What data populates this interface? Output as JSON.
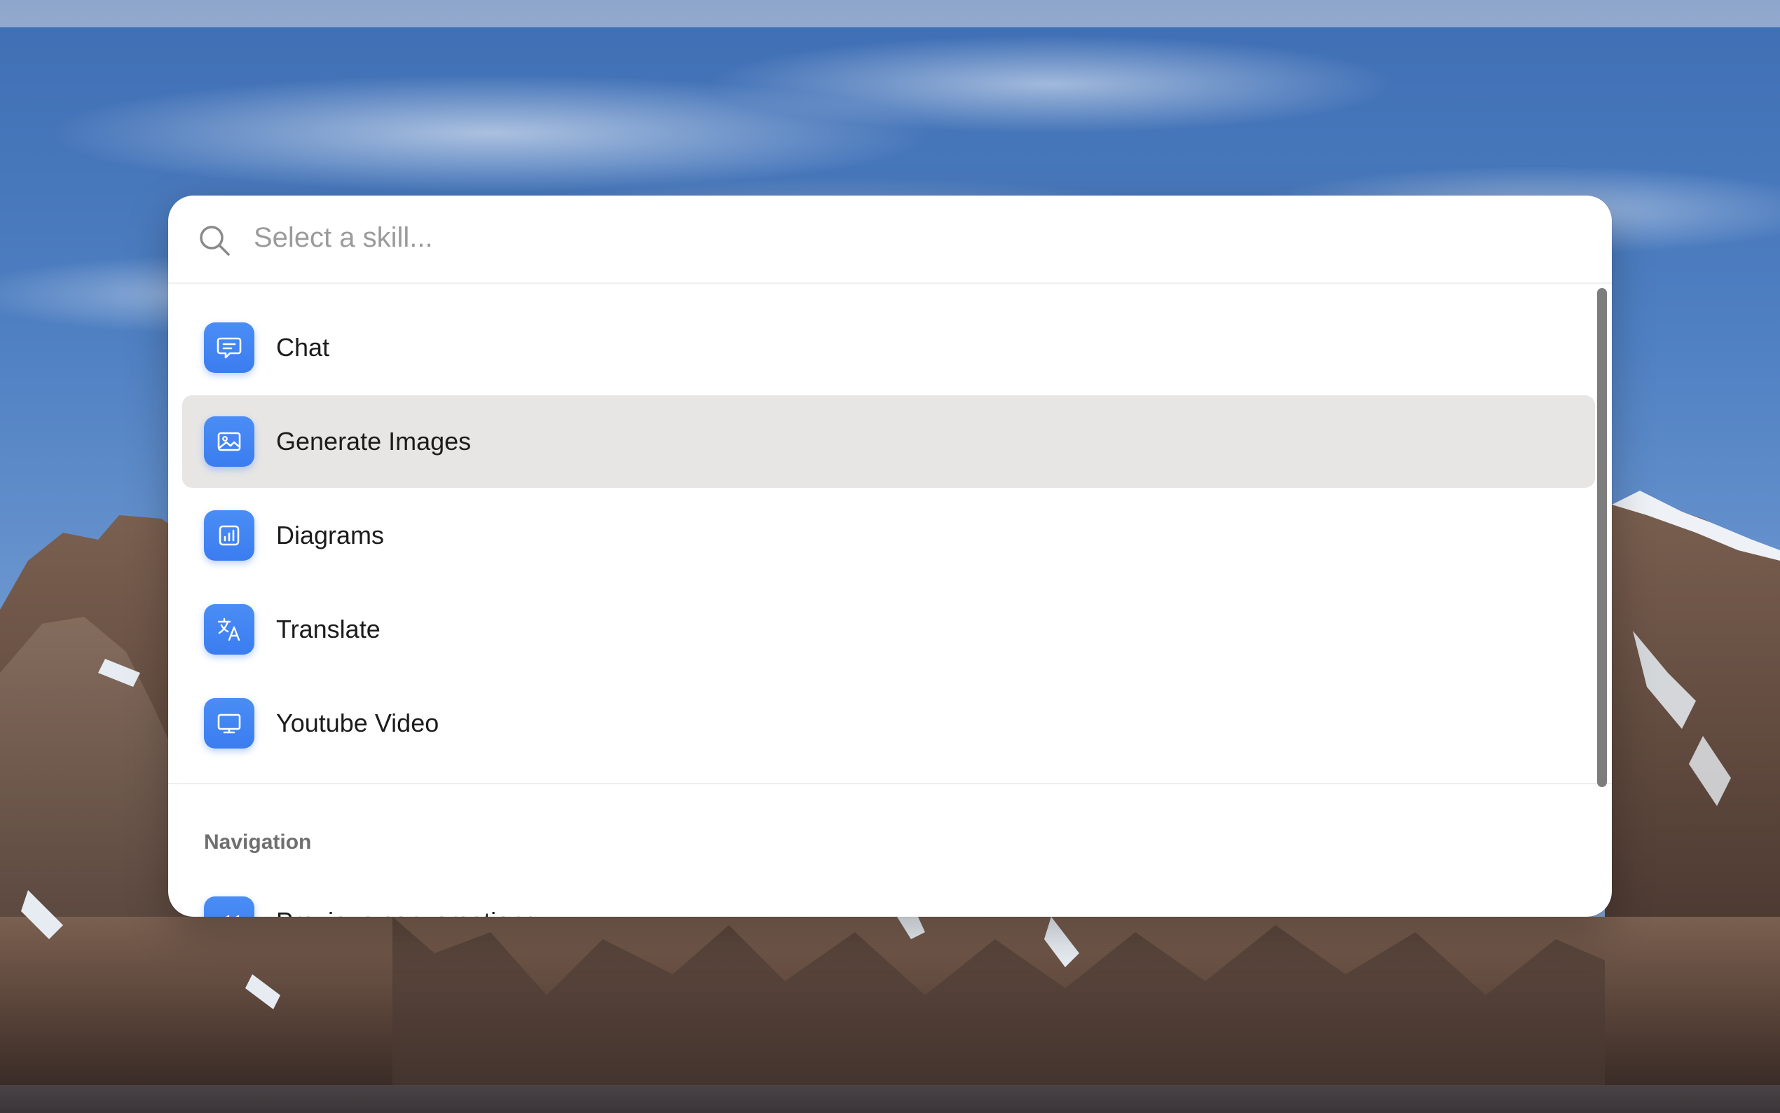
{
  "search": {
    "placeholder": "Select a skill...",
    "value": ""
  },
  "skills": [
    {
      "label": "Chat",
      "icon": "chat-bubble-icon"
    },
    {
      "label": "Generate Images",
      "icon": "image-icon"
    },
    {
      "label": "Diagrams",
      "icon": "bar-chart-icon"
    },
    {
      "label": "Translate",
      "icon": "translate-icon"
    },
    {
      "label": "Youtube Video",
      "icon": "monitor-icon"
    }
  ],
  "selected_skill": "Generate Images",
  "navigation": {
    "title": "Navigation",
    "items": [
      {
        "label": "Previous conversations",
        "icon": "rewind-icon"
      }
    ]
  },
  "colors": {
    "accent": "#3b7df0",
    "selected_row": "#e7e6e5",
    "panel": "#ffffff"
  }
}
